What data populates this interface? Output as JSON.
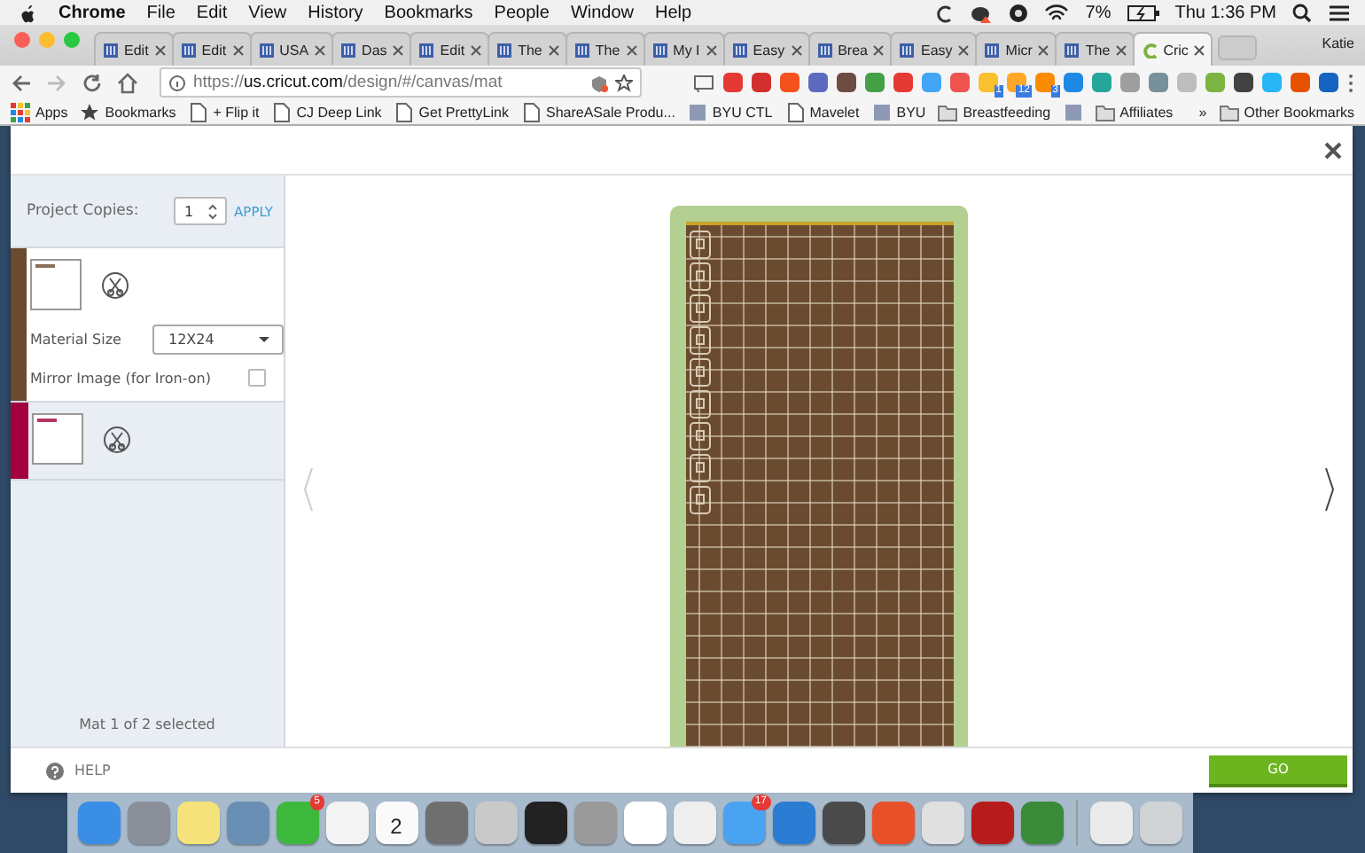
{
  "menubar": {
    "app": "Chrome",
    "menus": [
      "File",
      "Edit",
      "View",
      "History",
      "Bookmarks",
      "People",
      "Window",
      "Help"
    ],
    "battery": "7%",
    "clock": "Thu 1:36 PM"
  },
  "tabs": [
    {
      "title": "Edit",
      "selected": false
    },
    {
      "title": "Edit",
      "selected": false
    },
    {
      "title": "USA",
      "selected": false
    },
    {
      "title": "Das",
      "selected": false
    },
    {
      "title": "Edit",
      "selected": false
    },
    {
      "title": "The",
      "selected": false
    },
    {
      "title": "The",
      "selected": false
    },
    {
      "title": "My I",
      "selected": false
    },
    {
      "title": "Easy",
      "selected": false
    },
    {
      "title": "Brea",
      "selected": false
    },
    {
      "title": "Easy",
      "selected": false
    },
    {
      "title": "Micr",
      "selected": false
    },
    {
      "title": "The",
      "selected": false
    },
    {
      "title": "Cric",
      "selected": true
    }
  ],
  "profile": "Katie",
  "address": {
    "prefix": "https://",
    "host": "us.cricut.com",
    "path": "/design/#/canvas/mat"
  },
  "extensions": [
    {
      "color": "#e53935"
    },
    {
      "color": "#d32f2f"
    },
    {
      "color": "#f4511e"
    },
    {
      "color": "#5c6bc0"
    },
    {
      "color": "#6d4c41"
    },
    {
      "color": "#43a047"
    },
    {
      "color": "#e53935"
    },
    {
      "color": "#42a5f5"
    },
    {
      "color": "#ef5350"
    },
    {
      "color": "#fbc02d",
      "badge": "1"
    },
    {
      "color": "#ffa726",
      "badge": "12"
    },
    {
      "color": "#fb8c00",
      "badge": "3"
    },
    {
      "color": "#1e88e5"
    },
    {
      "color": "#26a69a"
    },
    {
      "color": "#9e9e9e"
    },
    {
      "color": "#78909c"
    },
    {
      "color": "#bdbdbd"
    },
    {
      "color": "#7cb342"
    },
    {
      "color": "#424242"
    },
    {
      "color": "#29b6f6"
    },
    {
      "color": "#e65100"
    },
    {
      "color": "#1565c0"
    }
  ],
  "bookmarks": [
    {
      "kind": "apps",
      "label": "Apps"
    },
    {
      "kind": "star",
      "label": "Bookmarks"
    },
    {
      "kind": "page",
      "label": "+ Flip it"
    },
    {
      "kind": "page",
      "label": "CJ Deep Link"
    },
    {
      "kind": "page",
      "label": "Get PrettyLink"
    },
    {
      "kind": "page",
      "label": "ShareASale Produ..."
    },
    {
      "kind": "site",
      "label": "BYU CTL"
    },
    {
      "kind": "page",
      "label": "Mavelet"
    },
    {
      "kind": "site",
      "label": "BYU"
    },
    {
      "kind": "folder",
      "label": "Breastfeeding"
    },
    {
      "kind": "site"
    },
    {
      "kind": "folder",
      "label": "Affiliates"
    }
  ],
  "bookmarks_more": "»",
  "other_bookmarks": "Other Bookmarks",
  "panel": {
    "copies_label": "Project Copies:",
    "copies": "1",
    "apply": "APPLY",
    "status": "Mat 1 of 2 selected"
  },
  "mats": [
    {
      "color": "#6b4a2e",
      "selected": true,
      "size_label": "Material Size",
      "size": "12X24",
      "mirror_label": "Mirror Image (for Iron-on)",
      "mirror": false
    },
    {
      "color": "#a3003f",
      "selected": false
    }
  ],
  "footer": {
    "help": "HELP",
    "go": "GO"
  },
  "dock": [
    {
      "color": "#3a8ee6"
    },
    {
      "color": "#8a8f99"
    },
    {
      "color": "#f5e27a"
    },
    {
      "color": "#6a8fb5"
    },
    {
      "color": "#3cb83c",
      "badge": "5"
    },
    {
      "color": "#f4f4f4"
    },
    {
      "color": "#fafafa",
      "date": "2"
    },
    {
      "color": "#6f6f6f"
    },
    {
      "color": "#c9c9c9"
    },
    {
      "color": "#222222"
    },
    {
      "color": "#9a9a9a"
    },
    {
      "color": "#ffffff"
    },
    {
      "color": "#eeeeee"
    },
    {
      "color": "#4aa3f0",
      "badge": "17"
    },
    {
      "color": "#2b7cd3"
    },
    {
      "color": "#4a4a4a"
    },
    {
      "color": "#e8502a"
    },
    {
      "color": "#e0e0e0"
    },
    {
      "color": "#b71c1c"
    },
    {
      "color": "#3a8a3a"
    },
    {
      "color": "#eaeaea"
    },
    {
      "color": "#cfd3d6"
    }
  ]
}
